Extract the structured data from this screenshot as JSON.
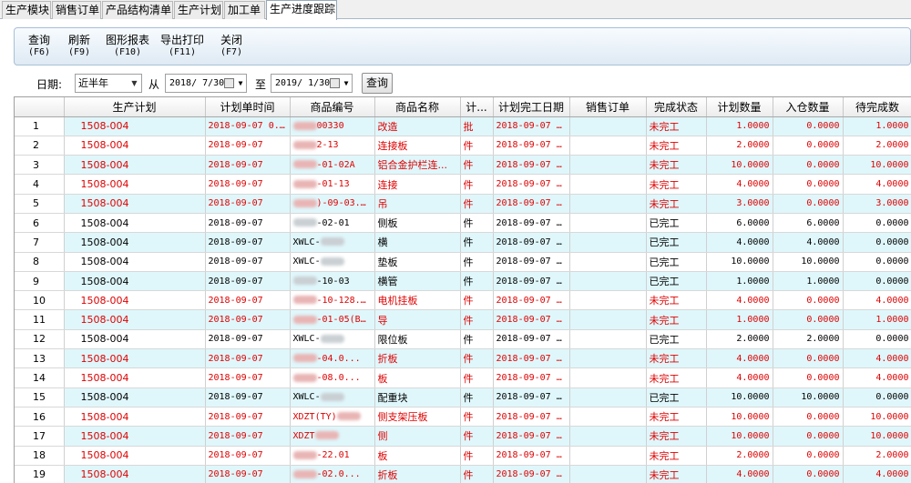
{
  "tabs": [
    "生产模块",
    "销售订单",
    "产品结构清单",
    "生产计划",
    "加工单",
    "生产进度跟踪"
  ],
  "toolbar": [
    {
      "label": "查询",
      "key": "(F6)"
    },
    {
      "label": "刷新",
      "key": "(F9)"
    },
    {
      "label": "图形报表",
      "key": "(F10)"
    },
    {
      "label": "导出打印",
      "key": "(F11)"
    },
    {
      "label": "关闭",
      "key": "(F7)"
    }
  ],
  "filter": {
    "date_label": "日期:",
    "period": "近半年",
    "from_label": "从",
    "from_date": "2018/ 7/30",
    "to_label": "至",
    "to_date": "2019/ 1/30",
    "query_button": "查询"
  },
  "columns": [
    "",
    "生产计划",
    "计划单时间",
    "商品编号",
    "商品名称",
    "计...",
    "计划完工日期",
    "销售订单",
    "完成状态",
    "计划数量",
    "入仓数量",
    "待完成数"
  ],
  "rows": [
    {
      "no": "1",
      "plan": "1508-004",
      "time": "2018-09-07 0...",
      "code": "00330",
      "name": "改造",
      "unit": "批",
      "finish": "2018-09-07 ...",
      "order": "",
      "status": "未完工",
      "qty": "1.0000",
      "stock": "0.0000",
      "pending": "1.0000",
      "red": true
    },
    {
      "no": "2",
      "plan": "1508-004",
      "time": "2018-09-07",
      "code": "2-13",
      "name": "连接板",
      "unit": "件",
      "finish": "2018-09-07 ...",
      "order": "",
      "status": "未完工",
      "qty": "2.0000",
      "stock": "0.0000",
      "pending": "2.0000",
      "red": true
    },
    {
      "no": "3",
      "plan": "1508-004",
      "time": "2018-09-07",
      "code": "-01-02A",
      "name": "铝合金护栏连...",
      "unit": "件",
      "finish": "2018-09-07 ...",
      "order": "",
      "status": "未完工",
      "qty": "10.0000",
      "stock": "0.0000",
      "pending": "10.0000",
      "red": true
    },
    {
      "no": "4",
      "plan": "1508-004",
      "time": "2018-09-07",
      "code": "-01-13",
      "name": "连接",
      "unit": "件",
      "finish": "2018-09-07 ...",
      "order": "",
      "status": "未完工",
      "qty": "4.0000",
      "stock": "0.0000",
      "pending": "4.0000",
      "red": true
    },
    {
      "no": "5",
      "plan": "1508-004",
      "time": "2018-09-07",
      "code": ")-09-03...",
      "name": "吊",
      "unit": "件",
      "finish": "2018-09-07 ...",
      "order": "",
      "status": "未完工",
      "qty": "3.0000",
      "stock": "0.0000",
      "pending": "3.0000",
      "red": true
    },
    {
      "no": "6",
      "plan": "1508-004",
      "time": "2018-09-07",
      "code": "-02-01",
      "name": "侧板",
      "unit": "件",
      "finish": "2018-09-07 ...",
      "order": "",
      "status": "已完工",
      "qty": "6.0000",
      "stock": "6.0000",
      "pending": "0.0000",
      "red": false
    },
    {
      "no": "7",
      "plan": "1508-004",
      "time": "2018-09-07",
      "code": "XWLC-",
      "name": "横",
      "unit": "件",
      "finish": "2018-09-07 ...",
      "order": "",
      "status": "已完工",
      "qty": "4.0000",
      "stock": "4.0000",
      "pending": "0.0000",
      "red": false
    },
    {
      "no": "8",
      "plan": "1508-004",
      "time": "2018-09-07",
      "code": "XWLC-",
      "name": "垫板",
      "unit": "件",
      "finish": "2018-09-07 ...",
      "order": "",
      "status": "已完工",
      "qty": "10.0000",
      "stock": "10.0000",
      "pending": "0.0000",
      "red": false
    },
    {
      "no": "9",
      "plan": "1508-004",
      "time": "2018-09-07",
      "code": "-10-03",
      "name": "横管",
      "unit": "件",
      "finish": "2018-09-07 ...",
      "order": "",
      "status": "已完工",
      "qty": "1.0000",
      "stock": "1.0000",
      "pending": "0.0000",
      "red": false
    },
    {
      "no": "10",
      "plan": "1508-004",
      "time": "2018-09-07",
      "code": "-10-128...",
      "name": "电机挂板",
      "unit": "件",
      "finish": "2018-09-07 ...",
      "order": "",
      "status": "未完工",
      "qty": "4.0000",
      "stock": "0.0000",
      "pending": "4.0000",
      "red": true
    },
    {
      "no": "11",
      "plan": "1508-004",
      "time": "2018-09-07",
      "code": "-01-05(B...",
      "name": "导",
      "unit": "件",
      "finish": "2018-09-07 ...",
      "order": "",
      "status": "未完工",
      "qty": "1.0000",
      "stock": "0.0000",
      "pending": "1.0000",
      "red": true
    },
    {
      "no": "12",
      "plan": "1508-004",
      "time": "2018-09-07",
      "code": "XWLC-",
      "name": "限位板",
      "unit": "件",
      "finish": "2018-09-07 ...",
      "order": "",
      "status": "已完工",
      "qty": "2.0000",
      "stock": "2.0000",
      "pending": "0.0000",
      "red": false
    },
    {
      "no": "13",
      "plan": "1508-004",
      "time": "2018-09-07",
      "code": "-04.0...",
      "name": "折板",
      "unit": "件",
      "finish": "2018-09-07 ...",
      "order": "",
      "status": "未完工",
      "qty": "4.0000",
      "stock": "0.0000",
      "pending": "4.0000",
      "red": true
    },
    {
      "no": "14",
      "plan": "1508-004",
      "time": "2018-09-07",
      "code": "-08.0...",
      "name": "板",
      "unit": "件",
      "finish": "2018-09-07 ...",
      "order": "",
      "status": "未完工",
      "qty": "4.0000",
      "stock": "0.0000",
      "pending": "4.0000",
      "red": true
    },
    {
      "no": "15",
      "plan": "1508-004",
      "time": "2018-09-07",
      "code": "XWLC-",
      "name": "配重块",
      "unit": "件",
      "finish": "2018-09-07 ...",
      "order": "",
      "status": "已完工",
      "qty": "10.0000",
      "stock": "10.0000",
      "pending": "0.0000",
      "red": false
    },
    {
      "no": "16",
      "plan": "1508-004",
      "time": "2018-09-07",
      "code": "XDZT(TY)",
      "name": "侧支架压板",
      "unit": "件",
      "finish": "2018-09-07 ...",
      "order": "",
      "status": "未完工",
      "qty": "10.0000",
      "stock": "0.0000",
      "pending": "10.0000",
      "red": true
    },
    {
      "no": "17",
      "plan": "1508-004",
      "time": "2018-09-07",
      "code": "XDZT",
      "name": "侧",
      "unit": "件",
      "finish": "2018-09-07 ...",
      "order": "",
      "status": "未完工",
      "qty": "10.0000",
      "stock": "0.0000",
      "pending": "10.0000",
      "red": true
    },
    {
      "no": "18",
      "plan": "1508-004",
      "time": "2018-09-07",
      "code": "-22.01",
      "name": "板",
      "unit": "件",
      "finish": "2018-09-07 ...",
      "order": "",
      "status": "未完工",
      "qty": "2.0000",
      "stock": "0.0000",
      "pending": "2.0000",
      "red": true
    },
    {
      "no": "19",
      "plan": "1508-004",
      "time": "2018-09-07",
      "code": "-02.0...",
      "name": "折板",
      "unit": "件",
      "finish": "2018-09-07 ...",
      "order": "",
      "status": "未完工",
      "qty": "4.0000",
      "stock": "0.0000",
      "pending": "4.0000",
      "red": true
    }
  ],
  "colors": {
    "incomplete": "#e00000",
    "complete": "#000000",
    "row_alt": "#dff7fb"
  }
}
